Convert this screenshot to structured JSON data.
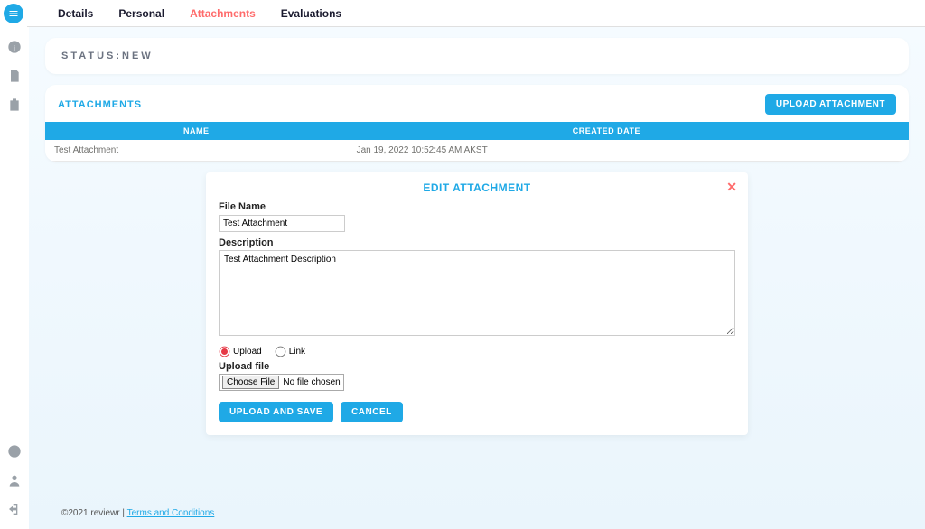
{
  "topnav": {
    "items": [
      {
        "label": "Details",
        "active": false
      },
      {
        "label": "Personal",
        "active": false
      },
      {
        "label": "Attachments",
        "active": true
      },
      {
        "label": "Evaluations",
        "active": false
      }
    ]
  },
  "status": {
    "label": "STATUS:NEW"
  },
  "attachments": {
    "title": "ATTACHMENTS",
    "upload_btn": "UPLOAD ATTACHMENT",
    "cols": {
      "name": "NAME",
      "date": "CREATED DATE"
    },
    "rows": [
      {
        "name": "Test Attachment",
        "date": "Jan 19, 2022 10:52:45 AM AKST"
      }
    ]
  },
  "edit": {
    "title": "EDIT ATTACHMENT",
    "close": "✕",
    "labels": {
      "filename": "File Name",
      "description": "Description",
      "upload_file": "Upload file"
    },
    "values": {
      "filename": "Test Attachment",
      "description": "Test Attachment Description"
    },
    "radios": {
      "upload": "Upload",
      "link": "Link"
    },
    "file": {
      "choose": "Choose File",
      "status": "No file chosen"
    },
    "buttons": {
      "save": "UPLOAD AND SAVE",
      "cancel": "CANCEL"
    }
  },
  "footer": {
    "copyright": "©2021 reviewr | ",
    "terms": "Terms and Conditions"
  }
}
